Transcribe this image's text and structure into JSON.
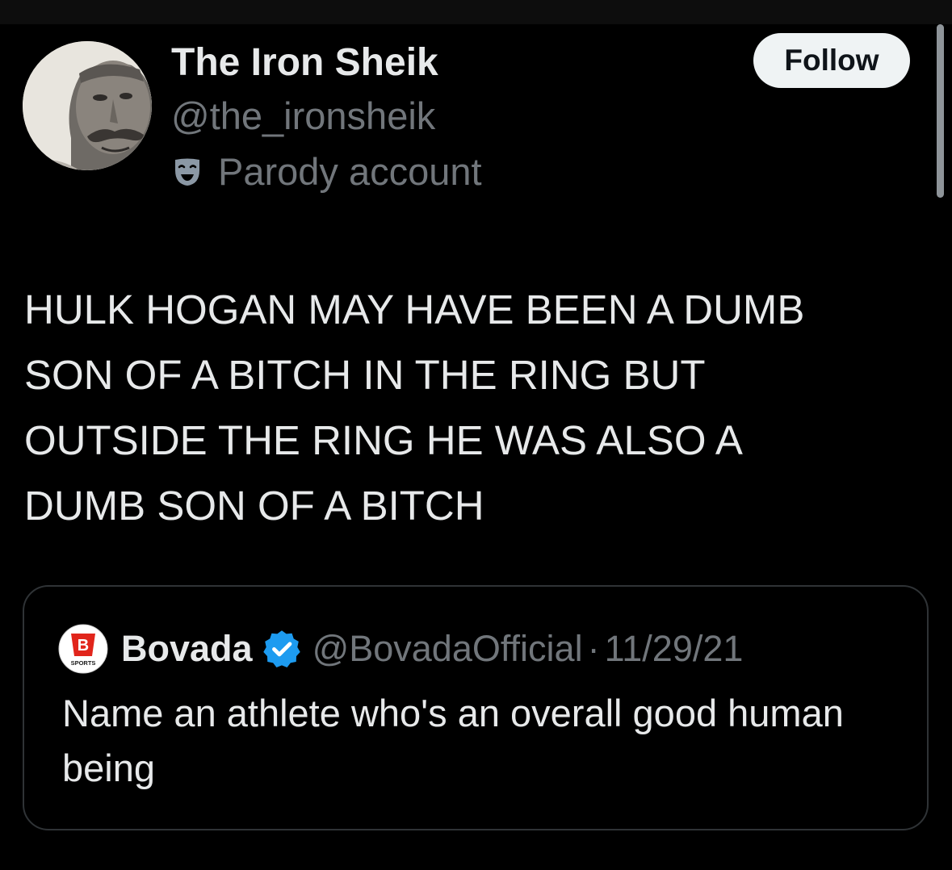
{
  "tweet": {
    "author": {
      "display_name": "The Iron Sheik",
      "handle": "@the_ironsheik",
      "label": "Parody account"
    },
    "follow_label": "Follow",
    "text_lines": [
      "HULK HOGAN MAY HAVE BEEN A DUMB",
      "SON OF A BITCH IN THE RING BUT",
      "OUTSIDE THE RING HE WAS ALSO A",
      "DUMB SON OF A BITCH"
    ]
  },
  "quoted_tweet": {
    "display_name": "Bovada",
    "handle": "@BovadaOfficial",
    "separator": "·",
    "date": "11/29/21",
    "text": "Name an athlete who's an overall good human being",
    "avatar_mark": "B",
    "avatar_caption": "SPORTS"
  },
  "icons": {
    "label_icon": "theater-mask-icon",
    "verified": "verified-badge-icon"
  },
  "colors": {
    "background": "#000000",
    "primary_text": "#e7e9ea",
    "secondary_text": "#71767b",
    "follow_bg": "#eff3f4",
    "verified": "#1d9bf0",
    "bovada_red": "#e1251b",
    "border": "#2f3336"
  }
}
